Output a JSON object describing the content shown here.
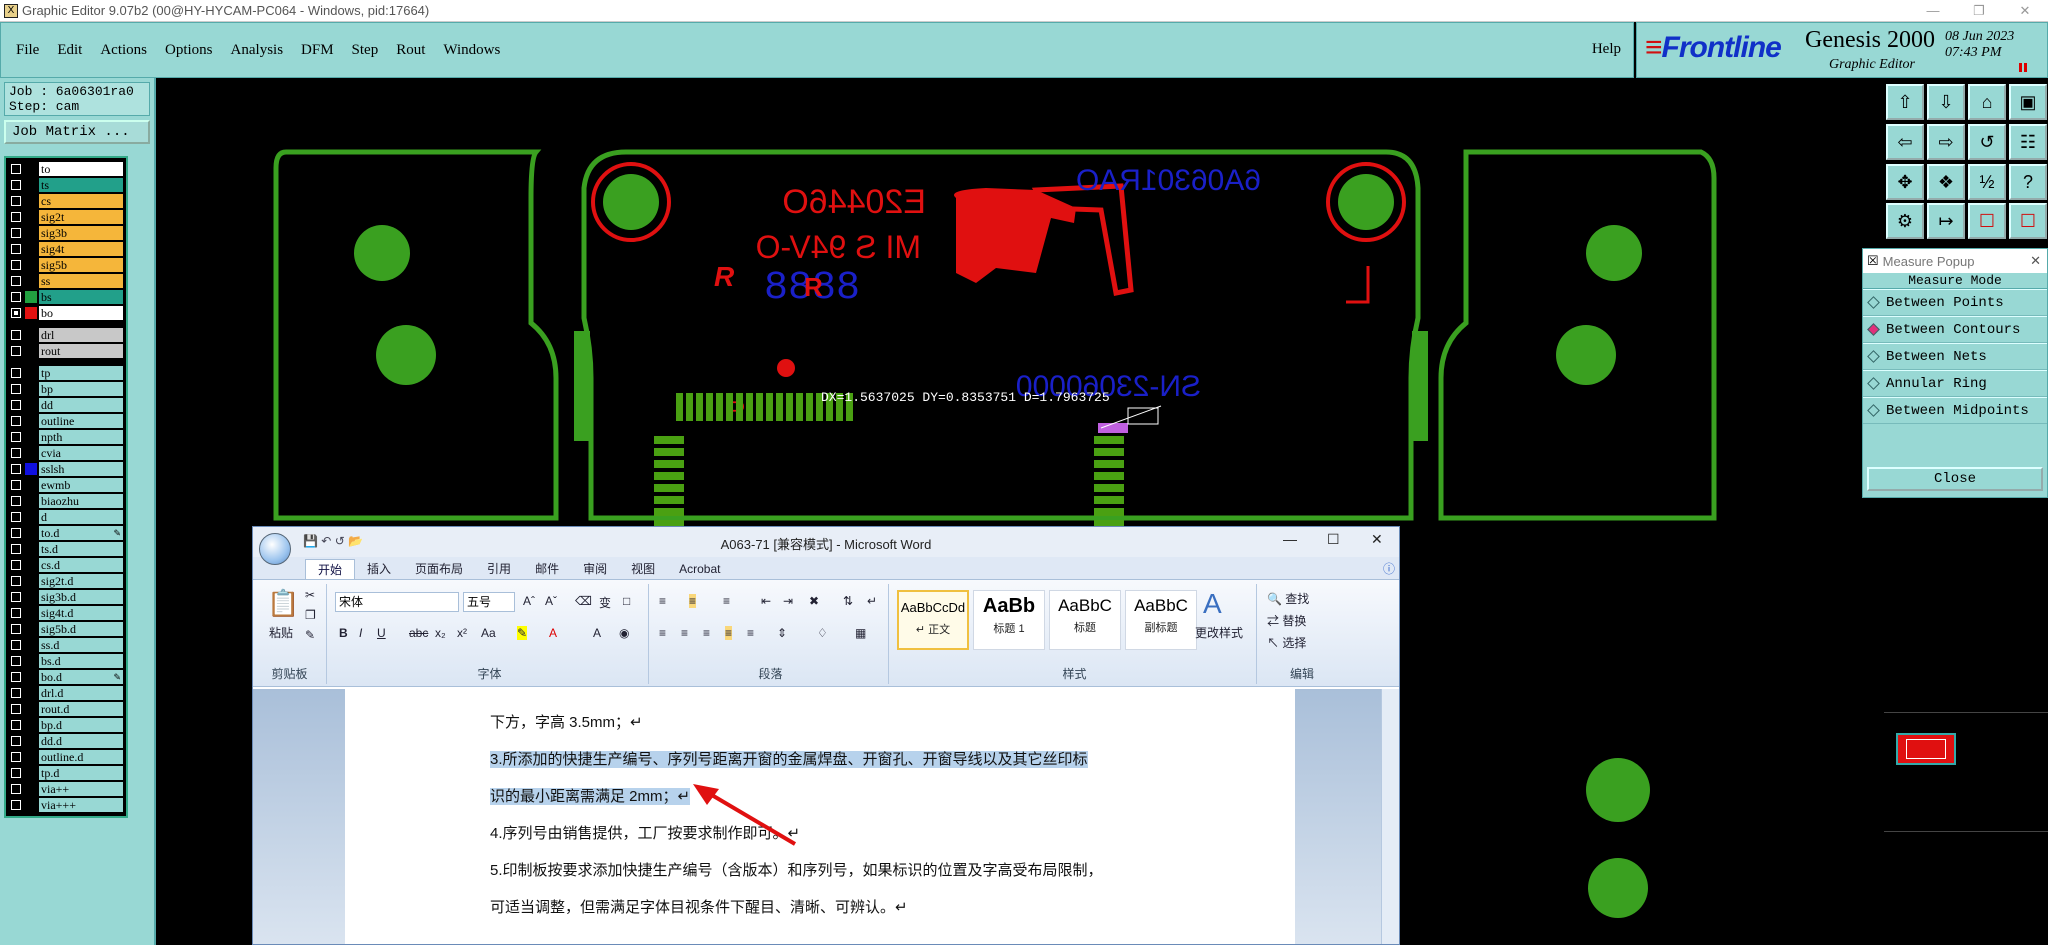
{
  "window": {
    "title": "Graphic Editor 9.07b2 (00@HY-HYCAM-PC064 - Windows, pid:17664)",
    "app_icon": "X"
  },
  "menu": {
    "items": [
      "File",
      "Edit",
      "Actions",
      "Options",
      "Analysis",
      "DFM",
      "Step",
      "Rout",
      "Windows"
    ],
    "help": "Help"
  },
  "brand": {
    "frontline": "Frontline",
    "product": "Genesis 2000",
    "subtitle": "Graphic Editor",
    "date": "08 Jun 2023",
    "time": "07:43 PM"
  },
  "job": {
    "job_line": "Job : 6a06301ra0",
    "step_line": "Step: cam",
    "matrix_button": "Job Matrix ..."
  },
  "layers": [
    {
      "name": "to",
      "color": "#ffffff",
      "sel": false
    },
    {
      "name": "ts",
      "color": "#22a08a",
      "sel": false
    },
    {
      "name": "cs",
      "color": "#f5b63a",
      "sel": false
    },
    {
      "name": "sig2t",
      "color": "#f5b63a",
      "sel": false
    },
    {
      "name": "sig3b",
      "color": "#f5b63a",
      "sel": false
    },
    {
      "name": "sig4t",
      "color": "#f5b63a",
      "sel": false
    },
    {
      "name": "sig5b",
      "color": "#f5b63a",
      "sel": false
    },
    {
      "name": "ss",
      "color": "#f5b63a",
      "sel": false
    },
    {
      "name": "bs",
      "color": "#22a08a",
      "swatch": "#22a040",
      "sel": false
    },
    {
      "name": "bo",
      "color": "#ffffff",
      "swatch": "#e01010",
      "sel": true
    },
    {
      "name": "drl",
      "color": "#c8c8c8",
      "sel": false,
      "gap": true
    },
    {
      "name": "rout",
      "color": "#c8c8c8",
      "sel": false
    },
    {
      "name": "tp",
      "color": "#98d8d4",
      "sel": false,
      "gap": true
    },
    {
      "name": "bp",
      "color": "#98d8d4",
      "sel": false
    },
    {
      "name": "dd",
      "color": "#98d8d4",
      "sel": false
    },
    {
      "name": "outline",
      "color": "#98d8d4",
      "sel": false
    },
    {
      "name": "npth",
      "color": "#98d8d4",
      "sel": false
    },
    {
      "name": "cvia",
      "color": "#98d8d4",
      "sel": false
    },
    {
      "name": "sslsh",
      "color": "#98d8d4",
      "swatch": "#1010e0",
      "sel": false
    },
    {
      "name": "ewmb",
      "color": "#98d8d4",
      "sel": false
    },
    {
      "name": "biaozhu",
      "color": "#98d8d4",
      "sel": false
    },
    {
      "name": "d",
      "color": "#98d8d4",
      "sel": false
    },
    {
      "name": "to.d",
      "color": "#98d8d4",
      "sel": false,
      "pencil": true
    },
    {
      "name": "ts.d",
      "color": "#98d8d4",
      "sel": false
    },
    {
      "name": "cs.d",
      "color": "#98d8d4",
      "sel": false
    },
    {
      "name": "sig2t.d",
      "color": "#98d8d4",
      "sel": false
    },
    {
      "name": "sig3b.d",
      "color": "#98d8d4",
      "sel": false
    },
    {
      "name": "sig4t.d",
      "color": "#98d8d4",
      "sel": false
    },
    {
      "name": "sig5b.d",
      "color": "#98d8d4",
      "sel": false
    },
    {
      "name": "ss.d",
      "color": "#98d8d4",
      "sel": false
    },
    {
      "name": "bs.d",
      "color": "#98d8d4",
      "sel": false
    },
    {
      "name": "bo.d",
      "color": "#98d8d4",
      "sel": false,
      "pencil": true
    },
    {
      "name": "drl.d",
      "color": "#98d8d4",
      "sel": false
    },
    {
      "name": "rout.d",
      "color": "#98d8d4",
      "sel": false
    },
    {
      "name": "bp.d",
      "color": "#98d8d4",
      "sel": false
    },
    {
      "name": "dd.d",
      "color": "#98d8d4",
      "sel": false
    },
    {
      "name": "outline.d",
      "color": "#98d8d4",
      "sel": false
    },
    {
      "name": "tp.d",
      "color": "#98d8d4",
      "sel": false
    },
    {
      "name": "via++",
      "color": "#98d8d4",
      "sel": false
    },
    {
      "name": "via+++",
      "color": "#98d8d4",
      "sel": false
    }
  ],
  "canvas": {
    "mirrored_text_1": "E20446O",
    "mirrored_text_2": "MI S 94V-O",
    "mirrored_text_3": "6A06301RAO",
    "digits": "8888",
    "serial": "SN-23060000",
    "measure_readout": "DX=1.5637025 DY=0.8353751 D=1.7963725",
    "ul_mark": "R",
    "side_mark": "U"
  },
  "measure_popup": {
    "title": "Measure Popup",
    "mode_title": "Measure Mode",
    "options": [
      "Between Points",
      "Between Contours",
      "Between Nets",
      "Annular Ring",
      "Between Midpoints"
    ],
    "selected": "Between Contours",
    "close": "Close"
  },
  "word": {
    "title": "A063-71 [兼容模式] - Microsoft Word",
    "tabs": [
      "开始",
      "插入",
      "页面布局",
      "引用",
      "邮件",
      "审阅",
      "视图",
      "Acrobat"
    ],
    "active_tab": "开始",
    "font_name": "宋体",
    "font_size": "五号",
    "groups": {
      "clipboard": "剪贴板",
      "font": "字体",
      "paragraph": "段落",
      "styles": "样式",
      "editing": "编辑"
    },
    "paste": "粘贴",
    "styles": [
      {
        "preview": "AaBbCcDd",
        "label": "↵ 正文"
      },
      {
        "preview": "AaBb",
        "label": "标题 1"
      },
      {
        "preview": "AaBbC",
        "label": "标题"
      },
      {
        "preview": "AaBbC",
        "label": "副标题"
      }
    ],
    "change_styles": "更改样式",
    "editing_items": [
      "查找",
      "替换",
      "选择"
    ],
    "doc_lines": [
      "下方，字高 3.5mm；↵",
      "3.所添加的快捷生产编号、序列号距离开窗的金属焊盘、开窗孔、开窗导线以及其它丝印标",
      "识的最小距离需满足 2mm；↵",
      "4.序列号由销售提供，工厂按要求制作即可。↵",
      "5.印制板按要求添加快捷生产编号（含版本）和序列号，如果标识的位置及字高受布局限制，",
      "可适当调整，但需满足字体目视条件下醒目、清晰、可辨认。↵"
    ]
  }
}
